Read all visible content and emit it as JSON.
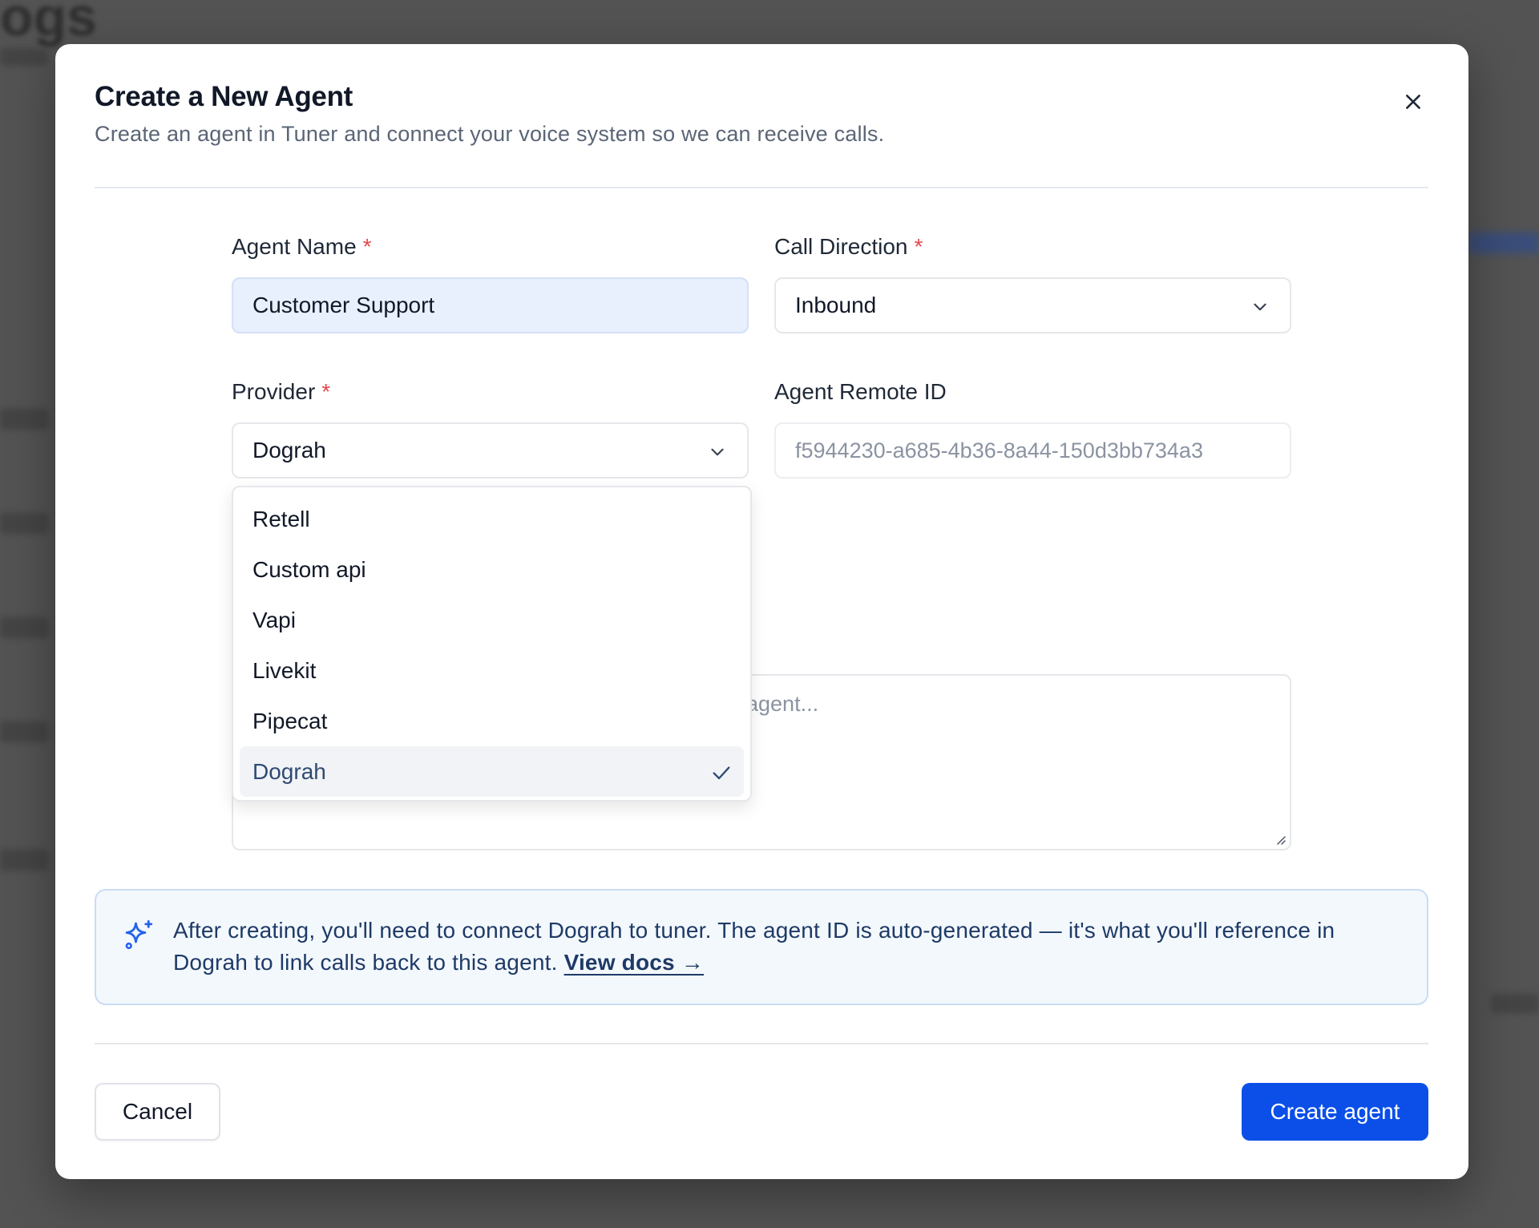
{
  "background": {
    "title_fragment": "ogs"
  },
  "modal": {
    "title": "Create a New Agent",
    "subtitle": "Create an agent in Tuner and connect your voice system so we can receive calls.",
    "close_icon": "close-icon"
  },
  "form": {
    "agent_name": {
      "label": "Agent Name",
      "required_mark": "*",
      "value": "Customer Support"
    },
    "call_direction": {
      "label": "Call Direction",
      "required_mark": "*",
      "value": "Inbound"
    },
    "provider": {
      "label": "Provider",
      "required_mark": "*",
      "value": "Dograh",
      "options": [
        "Retell",
        "Custom api",
        "Vapi",
        "Livekit",
        "Pipecat",
        "Dograh"
      ],
      "selected_index": 5
    },
    "agent_remote_id": {
      "label": "Agent Remote ID",
      "value": "f5944230-a685-4b36-8a44-150d3bb734a3"
    },
    "description": {
      "placeholder_visible": "agent..."
    }
  },
  "info": {
    "icon": "sparkles-icon",
    "text": "After creating, you'll need to connect Dograh to tuner. The agent ID is auto-generated — it's what you'll reference in Dograh to link calls back to this agent.",
    "link_text": "View docs →"
  },
  "footer": {
    "cancel_label": "Cancel",
    "create_label": "Create agent"
  },
  "colors": {
    "primary": "#0b4fe8",
    "required": "#e5484d",
    "info_bg": "#f3f8fd",
    "info_text": "#1e3a66",
    "filled_input_bg": "#e8f0fe"
  }
}
